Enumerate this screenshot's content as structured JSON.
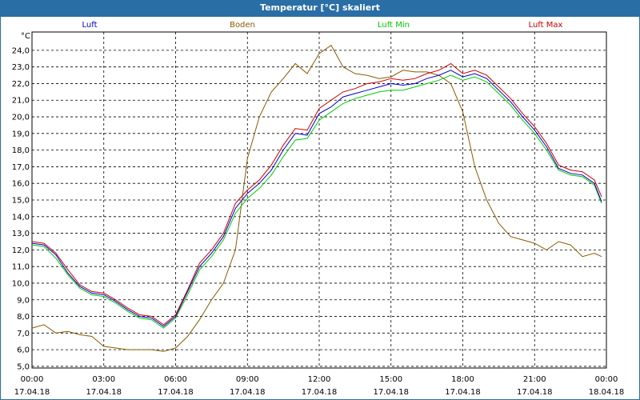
{
  "window": {
    "title": "Temperatur [°C] skaliert"
  },
  "chart_data": {
    "type": "line",
    "title": "Temperatur [°C] skaliert",
    "ylabel": "°C",
    "xlabel": "",
    "ylim": [
      4.9,
      25.1
    ],
    "y_ticks": [
      "5,0",
      "6,0",
      "7,0",
      "8,0",
      "9,0",
      "10,0",
      "11,0",
      "12,0",
      "13,0",
      "14,0",
      "15,0",
      "16,0",
      "17,0",
      "18,0",
      "19,0",
      "20,0",
      "21,0",
      "22,0",
      "23,0",
      "24,0"
    ],
    "x_ticks": [
      {
        "time": "00:00",
        "date": "17.04.18"
      },
      {
        "time": "03:00",
        "date": "17.04.18"
      },
      {
        "time": "06:00",
        "date": "17.04.18"
      },
      {
        "time": "09:00",
        "date": "17.04.18"
      },
      {
        "time": "12:00",
        "date": "17.04.18"
      },
      {
        "time": "15:00",
        "date": "17.04.18"
      },
      {
        "time": "18:00",
        "date": "17.04.18"
      },
      {
        "time": "21:00",
        "date": "17.04.18"
      },
      {
        "time": "00:00",
        "date": "18.04.18"
      }
    ],
    "xlim_hours": [
      0,
      24
    ],
    "grid": true,
    "legend_position": "top",
    "x_hours": [
      0,
      0.5,
      1,
      1.5,
      2,
      2.5,
      3,
      3.5,
      4,
      4.5,
      5,
      5.5,
      6,
      6.5,
      7,
      7.5,
      8,
      8.5,
      9,
      9.5,
      10,
      10.5,
      11,
      11.5,
      12,
      12.5,
      13,
      13.5,
      14,
      14.5,
      15,
      15.5,
      16,
      16.5,
      17,
      17.5,
      18,
      18.5,
      19,
      19.5,
      20,
      20.5,
      21,
      21.5,
      22,
      22.5,
      23,
      23.5,
      23.8
    ],
    "series": [
      {
        "name": "Luft",
        "color": "#0000cc",
        "values": [
          12.4,
          12.3,
          11.7,
          10.6,
          9.8,
          9.4,
          9.3,
          8.9,
          8.4,
          8.0,
          7.9,
          7.4,
          8.0,
          9.5,
          11.0,
          11.8,
          12.8,
          14.5,
          15.4,
          16.0,
          16.8,
          18.0,
          19.0,
          18.9,
          20.2,
          20.6,
          21.2,
          21.4,
          21.6,
          21.8,
          22.0,
          21.9,
          22.0,
          22.3,
          22.5,
          22.8,
          22.4,
          22.6,
          22.3,
          21.6,
          20.9,
          20.0,
          19.2,
          18.2,
          16.9,
          16.6,
          16.5,
          16.0,
          14.9
        ]
      },
      {
        "name": "Boden",
        "color": "#8b5a00",
        "values": [
          7.3,
          7.5,
          7.0,
          7.1,
          6.9,
          6.8,
          6.2,
          6.1,
          6.0,
          6.0,
          6.0,
          5.9,
          6.1,
          6.8,
          7.8,
          9.0,
          10.0,
          12.0,
          17.5,
          20.0,
          21.5,
          22.3,
          23.2,
          22.6,
          23.8,
          24.3,
          23.0,
          22.6,
          22.5,
          22.3,
          22.4,
          22.8,
          22.7,
          22.7,
          22.5,
          22.0,
          20.3,
          17.0,
          15.0,
          13.6,
          12.8,
          12.6,
          12.4,
          12.0,
          12.5,
          12.3,
          11.6,
          11.8,
          11.6
        ]
      },
      {
        "name": "Luft Min",
        "color": "#00cc00",
        "values": [
          12.3,
          12.2,
          11.5,
          10.5,
          9.7,
          9.3,
          9.2,
          8.8,
          8.3,
          7.9,
          7.8,
          7.3,
          7.9,
          9.3,
          10.8,
          11.6,
          12.6,
          14.2,
          15.1,
          15.7,
          16.5,
          17.6,
          18.6,
          18.7,
          19.8,
          20.3,
          20.8,
          21.1,
          21.3,
          21.5,
          21.6,
          21.6,
          21.8,
          22.0,
          22.2,
          22.5,
          22.2,
          22.4,
          22.1,
          21.4,
          20.7,
          19.8,
          19.0,
          18.0,
          16.8,
          16.5,
          16.4,
          15.9,
          14.8
        ]
      },
      {
        "name": "Luft Max",
        "color": "#cc0000",
        "values": [
          12.5,
          12.4,
          11.8,
          10.8,
          9.9,
          9.5,
          9.4,
          9.0,
          8.5,
          8.1,
          8.0,
          7.5,
          8.1,
          9.6,
          11.2,
          12.0,
          13.0,
          14.8,
          15.6,
          16.2,
          17.1,
          18.3,
          19.3,
          19.2,
          20.5,
          21.0,
          21.5,
          21.7,
          22.0,
          22.1,
          22.3,
          22.2,
          22.3,
          22.6,
          22.8,
          23.2,
          22.6,
          22.8,
          22.5,
          21.8,
          21.1,
          20.2,
          19.4,
          18.4,
          17.1,
          16.8,
          16.7,
          16.2,
          15.2
        ]
      }
    ]
  }
}
